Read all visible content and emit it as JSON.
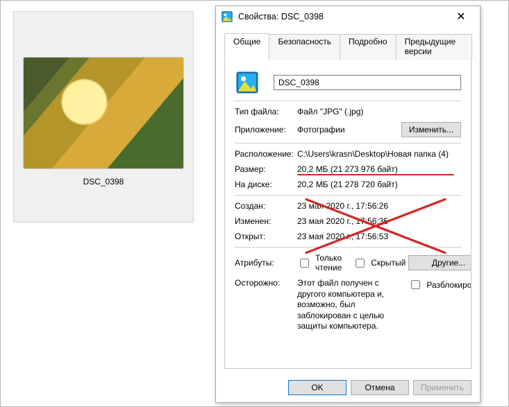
{
  "thumbnail": {
    "caption": "DSC_0398"
  },
  "dialog": {
    "title": "Свойства: DSC_0398",
    "tabs": {
      "general": "Общие",
      "security": "Безопасность",
      "details": "Подробно",
      "previous": "Предыдущие версии"
    },
    "filename": "DSC_0398",
    "labels": {
      "type": "Тип файла:",
      "app": "Приложение:",
      "change_btn": "Изменить...",
      "location": "Расположение:",
      "size": "Размер:",
      "size_on_disk": "На диске:",
      "created": "Создан:",
      "modified": "Изменен:",
      "accessed": "Открыт:",
      "attributes": "Атрибуты:",
      "readonly": "Только чтение",
      "hidden": "Скрытый",
      "other_btn": "Другие...",
      "caution": "Осторожно:",
      "unblock": "Разблокировать"
    },
    "values": {
      "type": "Файл \"JPG\" (.jpg)",
      "app": "Фотографии",
      "location": "C:\\Users\\krasn\\Desktop\\Новая папка (4)",
      "size": "20,2 МБ (21 273 976 байт)",
      "size_on_disk": "20,2 МБ (21 278 720 байт)",
      "created": "23 мая 2020 г., 17:56:26",
      "modified": "23 мая 2020 г., 17:56:35",
      "accessed": "23 мая 2020 г., 17:56:53",
      "caution_text": "Этот файл получен с другого компьютера и, возможно, был заблокирован с целью защиты компьютера."
    },
    "footer": {
      "ok": "OK",
      "cancel": "Отмена",
      "apply": "Применить"
    }
  }
}
